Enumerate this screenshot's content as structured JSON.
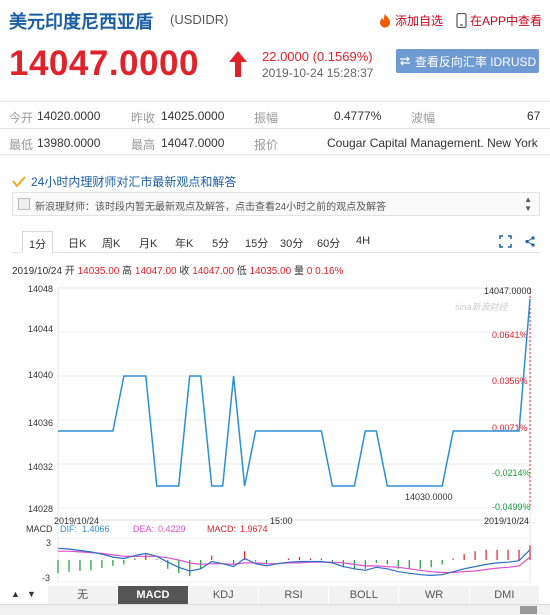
{
  "header": {
    "title": "美元印度尼西亚盾",
    "code": "(USDIDR)",
    "add_fav": "添加自选",
    "app_view": "在APP中查看"
  },
  "price": {
    "last": "14047.0000",
    "change": "22.0000 (0.1569%)",
    "time": "2019-10-24 15:28:37",
    "reverse_btn": "查看反向汇率 IDRUSD"
  },
  "quote": {
    "open_label": "今开",
    "open": "14020.0000",
    "prev_label": "昨收",
    "prev": "14025.0000",
    "amp_label": "振幅",
    "amp": "0.4777%",
    "wave_label": "波幅",
    "wave": "67",
    "low_label": "最低",
    "low": "13980.0000",
    "high_label": "最高",
    "high": "14047.0000",
    "quoter_label": "报价",
    "quoter": "Cougar Capital Management. New York"
  },
  "advisor": {
    "heading": "24小时内理财师对汇市最新观点和解答",
    "message": "新浪理财师：该时段内暂无最新观点及解答，点击查看24小时之前的观点及解答"
  },
  "tabs": [
    "1分",
    "日K",
    "周K",
    "月K",
    "年K",
    "5分",
    "15分",
    "30分",
    "60分",
    "4H"
  ],
  "chart_info": {
    "date": "2019/10/24",
    "open_label": "开",
    "open": "14035.00",
    "high_label": "高",
    "high": "14047.00",
    "close_label": "收",
    "close": "14047.00",
    "low_label": "低",
    "low": "14035.00",
    "vol_label": "量",
    "vol": "0",
    "pct": "0.16%"
  },
  "watermark": "sina新浪财经",
  "chart_data": {
    "type": "line",
    "y_ticks": [
      "14048",
      "14044",
      "14040",
      "14036",
      "14032",
      "14028"
    ],
    "ylim": [
      14028,
      14048
    ],
    "pct_ticks": [
      "0.0641%",
      "0.0356%",
      "0.0071%",
      "-0.0214%",
      "-0.0499%"
    ],
    "x_ticks": [
      "2019/10/24",
      "15:00",
      "2019/10/24"
    ],
    "max_label": "14047.0000",
    "min_label": "14030.0000",
    "series": [
      {
        "values": [
          14035,
          14035,
          14035,
          14035,
          14035,
          14035,
          14040,
          14040,
          14040,
          14030,
          14030,
          14030,
          14040,
          14040,
          14030,
          14030,
          14040,
          14030,
          14035,
          14035,
          14035,
          14035,
          14035,
          14035,
          14035,
          14030,
          14030,
          14030,
          14035,
          14035,
          14030,
          14030,
          14030,
          14030,
          14030,
          14030,
          14035,
          14035,
          14035,
          14035,
          14035,
          14035,
          14035,
          14047
        ]
      }
    ]
  },
  "macd": {
    "title": "MACD",
    "dif_label": "DIF:",
    "dif": "1.4066",
    "dea_label": "DEA:",
    "dea": "0.4229",
    "macd_label": "MACD:",
    "macd": "1.9674",
    "y_top": "3",
    "y_bottom": "-3",
    "ylim": [
      -3,
      3
    ],
    "dif_series": [
      1.6,
      1.5,
      1.3,
      1.1,
      0.8,
      0.4,
      0.2,
      0.6,
      0.9,
      0.5,
      -0.3,
      -1.0,
      -1.5,
      -1.2,
      -0.2,
      -0.5,
      -0.9,
      0.2,
      -0.5,
      -0.8,
      -0.5,
      -0.3,
      -0.2,
      -0.2,
      -0.2,
      -0.4,
      -0.9,
      -1.2,
      -1.4,
      -1.0,
      -1.2,
      -1.6,
      -1.8,
      -2.0,
      -2.1,
      -2.0,
      -1.6,
      -1.2,
      -0.9,
      -0.6,
      -0.4,
      -0.3,
      -0.1,
      1.4
    ],
    "dea_series": [
      1.2,
      1.2,
      1.1,
      1.0,
      0.9,
      0.7,
      0.5,
      0.5,
      0.5,
      0.5,
      0.3,
      0.0,
      -0.4,
      -0.6,
      -0.5,
      -0.5,
      -0.6,
      -0.4,
      -0.4,
      -0.5,
      -0.5,
      -0.4,
      -0.4,
      -0.3,
      -0.3,
      -0.3,
      -0.4,
      -0.6,
      -0.8,
      -0.8,
      -0.9,
      -1.0,
      -1.2,
      -1.4,
      -1.6,
      -1.7,
      -1.7,
      -1.6,
      -1.5,
      -1.3,
      -1.1,
      -1.0,
      -0.8,
      0.4
    ],
    "hist": [
      -1.8,
      -1.6,
      -1.5,
      -1.4,
      -1.1,
      -0.8,
      -0.6,
      0.2,
      0.8,
      0.1,
      -1.2,
      -1.8,
      -2.2,
      -1.2,
      0.6,
      0.0,
      -0.6,
      1.2,
      -0.2,
      -0.6,
      0.0,
      0.2,
      0.4,
      0.2,
      0.2,
      -0.2,
      -1.0,
      -1.2,
      -1.2,
      -0.4,
      -0.6,
      -1.2,
      -1.2,
      -1.2,
      -1.0,
      -0.6,
      0.2,
      0.8,
      1.2,
      1.4,
      1.4,
      1.4,
      1.4,
      2.0
    ]
  },
  "indicators": [
    "无",
    "MACD",
    "KDJ",
    "RSI",
    "BOLL",
    "WR",
    "DMI"
  ],
  "colors": {
    "up": "#e0222a",
    "down": "#1a9c3a",
    "line": "#2b8fd6",
    "accent": "#1b5fa3"
  }
}
